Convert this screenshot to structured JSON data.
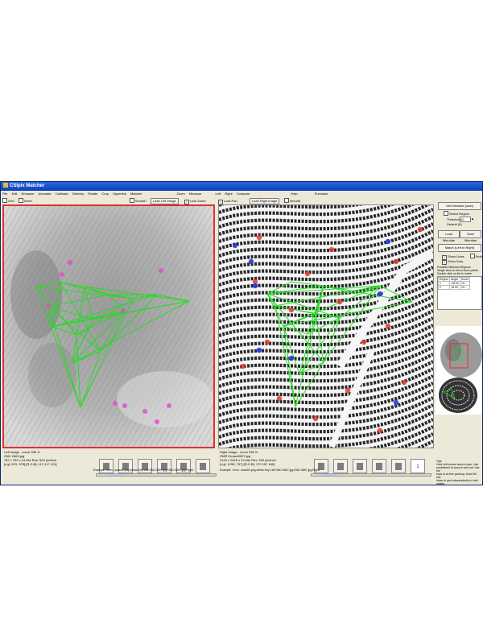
{
  "title": "CSIpix Matcher",
  "menu": [
    "File",
    "Edit",
    "Enhance",
    "Annotate",
    "Calibrate",
    "Delivery",
    "Rotate",
    "Crop",
    "Hyperlink",
    "Matcher",
    "Zoom",
    "Measure",
    "Left",
    "Right",
    "Compare",
    "Help",
    "Purchase"
  ],
  "toolbar_left": {
    "grid_label": "Grid",
    "invert_label": "Invert",
    "smooth_label": "Smooth",
    "load_left_label": "Load Left Image",
    "lock_zoom_label": "Lock Zoom"
  },
  "toolbar_right": {
    "lock_pan_label": "Lock Pan",
    "load_right_label": "Load Right Image",
    "smooth_label": "Smooth"
  },
  "side": {
    "get_minutiae_label": "Get Minutiae (auto)",
    "select_region_label": "Select Region",
    "threshold_label": "Threshold",
    "threshold_value": "40",
    "default_label": "Default",
    "default_value": "(5)",
    "load_minutiae_label": "Load Minutiae",
    "save_minutiae_label": "Save Minutiae",
    "match_label": "Match (Left to Right)",
    "show_lines_label": "Show Lines",
    "bold_label": "Bold",
    "show_dots_label": "Show Dots",
    "possible_title": "Possible Matched Regions",
    "possible_hint1": "Single click on list to show points",
    "possible_hint2": "Double click on list to rotate",
    "table_headers": [
      "Region",
      "Angle",
      "Score"
    ],
    "table_rows": [
      [
        "1",
        "-28.00",
        "10..."
      ],
      [
        "2",
        "15.00",
        "10..."
      ]
    ],
    "tips": [
      "Tips:",
      "Hold Left mouse down to pan. Use",
      "scrollwheel to zoom in and out. Use the",
      "keys to do fine panning. Hold Ctrl key",
      "down to pan independently in both panels."
    ]
  },
  "left_status": [
    "Left Image - zoom 336 %",
    "OM1 1863.jpg",
    "787 x 762 x 24 bits    Res: 500 pix/inch",
    "[x,y]: 870, 575]    [R,G,B]: 112 117 124]"
  ],
  "right_status": [
    "Right Image - zoom 336 %",
    "OMR Known0007.jpg",
    "2124 x 2616 x 24 bits    Res: 500 pix/inch",
    "[x,y]: 1295, 757]    [R,G,B]: 170 157 160]"
  ],
  "left_example": "Example : from : scan02.png shims Key Left OM1 0807.jpg OM1 0807.jpg Right",
  "right_example": "Example : from : scan02.png shims Key Left OM1 0807.jpg OM1 0807.jpg Right",
  "page_num": "1",
  "colors": {
    "match_lines": "#22dd22",
    "left_minutiae": "#e050c8",
    "right_red": "#e33a2a",
    "right_blue": "#2a3ae3",
    "selection_border": "#e0302f"
  }
}
